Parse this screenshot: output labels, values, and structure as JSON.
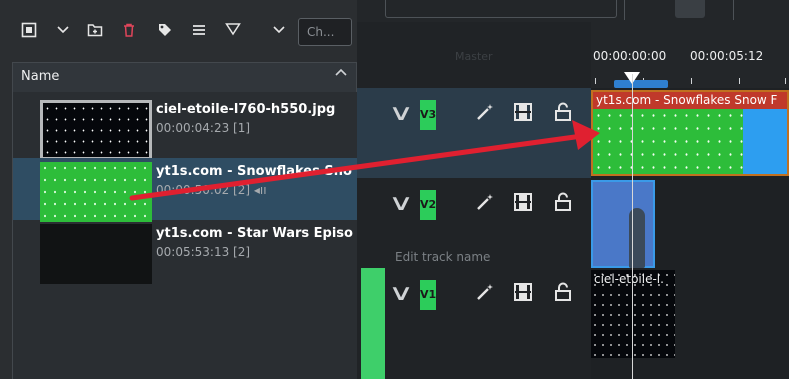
{
  "bin_toolbar": {
    "filter_placeholder": "Ch..."
  },
  "bin_header": {
    "name_column": "Name"
  },
  "clips": [
    {
      "title": "ciel-etoile-l760-h550.jpg",
      "meta": "00:00:04:23 [1]"
    },
    {
      "title": "yt1s.com - Snowflakes Sno",
      "meta": "00:00:50:02 [2] ◂ıı"
    },
    {
      "title": "yt1s.com - Star Wars Episo",
      "meta": "00:05:53:13 [2]"
    }
  ],
  "timeline": {
    "master_label": "Master",
    "timecodes": [
      "00:00:00:00",
      "00:00:05:12"
    ],
    "tracks": [
      {
        "name": "V3"
      },
      {
        "name": "V2",
        "edit_placeholder": "Edit track name"
      },
      {
        "name": "V1"
      }
    ],
    "clip_v3_label": "yt1s.com - Snowflakes Snow F",
    "clip_v1_label": "ciel-etoile-l."
  },
  "colors": {
    "track_green": "#2ccc5a",
    "arrow_red": "#e02030",
    "selection": "#2f4d63"
  }
}
